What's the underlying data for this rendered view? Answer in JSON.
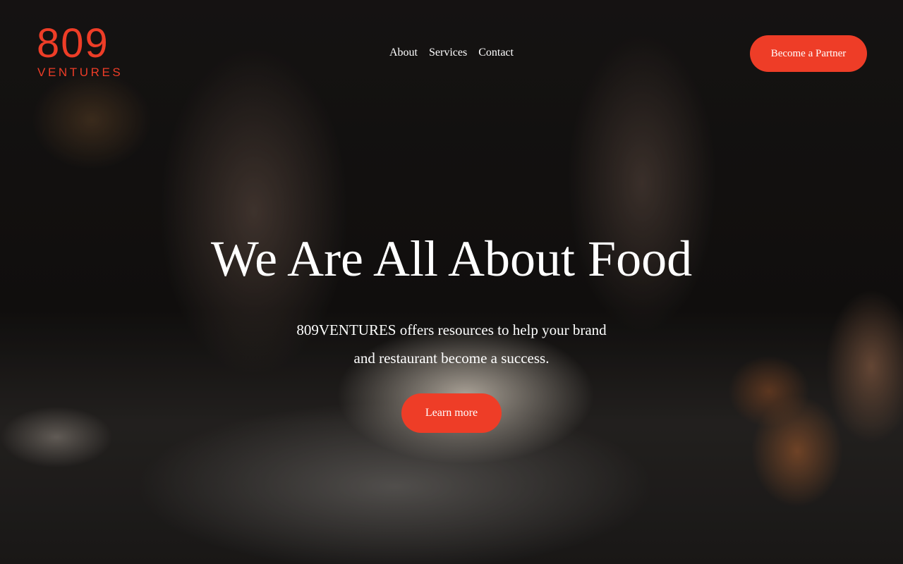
{
  "brand": {
    "logo_number": "809",
    "logo_word": "VENTURES",
    "accent_color": "#ee3d27"
  },
  "nav": {
    "items": [
      {
        "label": "About"
      },
      {
        "label": "Services"
      },
      {
        "label": "Contact"
      }
    ],
    "cta_label": "Become a Partner"
  },
  "hero": {
    "title": "We Are All About Food",
    "subtitle_line1": "809VENTURES offers resources to help your brand",
    "subtitle_line2": "and restaurant become a success.",
    "button_label": "Learn more"
  }
}
